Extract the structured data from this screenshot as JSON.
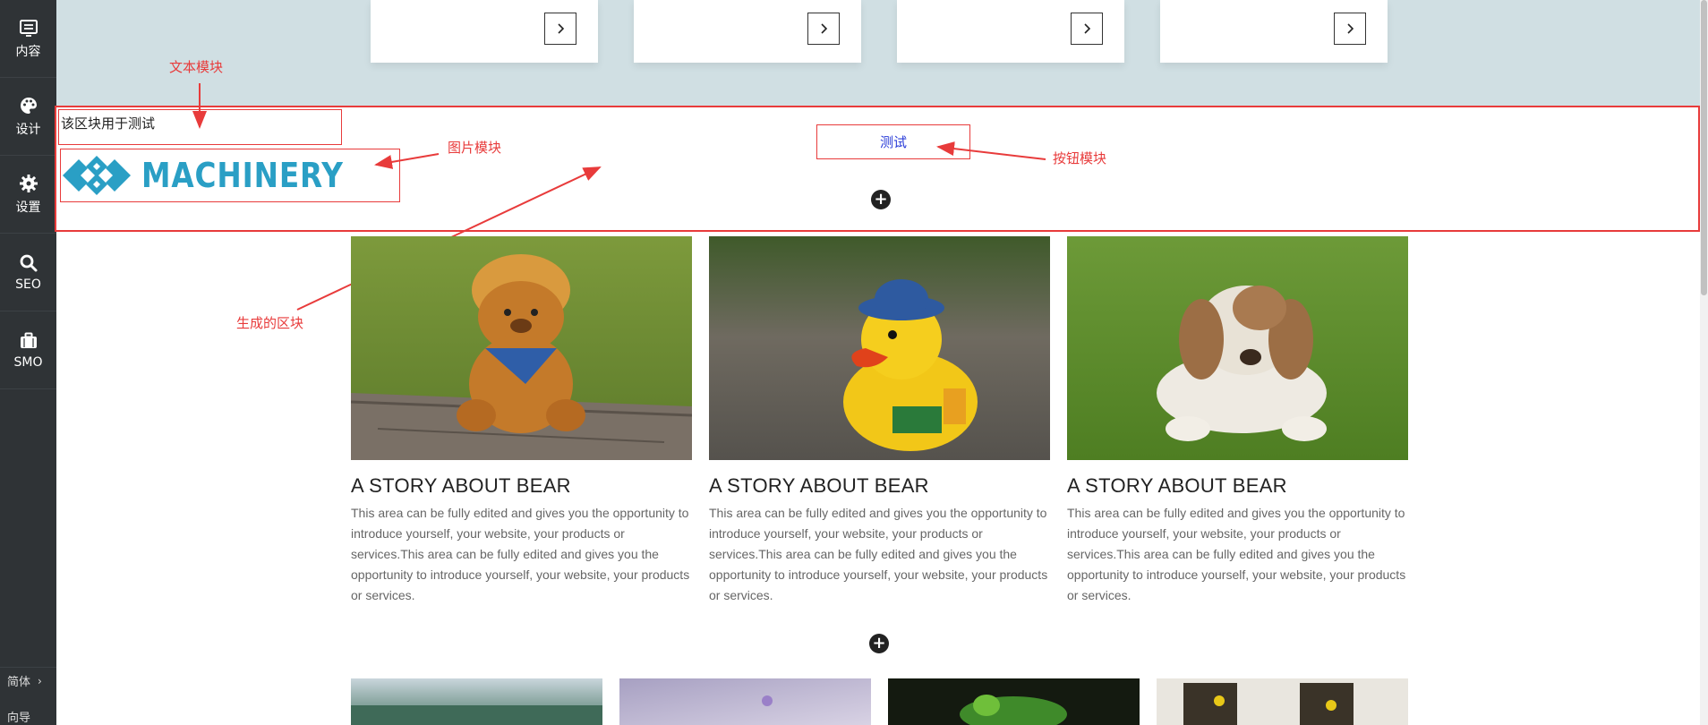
{
  "sidebar": {
    "items": [
      {
        "label": "内容",
        "icon": "content-icon"
      },
      {
        "label": "设计",
        "icon": "palette-icon"
      },
      {
        "label": "设置",
        "icon": "gear-icon"
      },
      {
        "label": "SEO",
        "icon": "search-icon"
      },
      {
        "label": "SMO",
        "icon": "briefcase-icon"
      }
    ],
    "language": "简体",
    "guide": "向导"
  },
  "top_cards": {
    "arrow_icon": "chevron-right-icon",
    "count": 4
  },
  "generated_block": {
    "text_module": "该区块用于测试",
    "logo_text": "MACHINERY",
    "button_label": "测试"
  },
  "annotations": {
    "text_module": "文本模块",
    "image_module": "图片模块",
    "button_module": "按钮模块",
    "generated_block": "生成的区块"
  },
  "cards": [
    {
      "title": "A STORY ABOUT BEAR",
      "body": "This area can be fully edited and gives you the opportunity to introduce yourself, your website, your products or services.This area can be fully edited and gives you the opportunity to introduce yourself, your website, your products or services.",
      "image": "teddy-bear-photo"
    },
    {
      "title": "A STORY ABOUT BEAR",
      "body": "This area can be fully edited and gives you the opportunity to introduce yourself, your website, your products or services.This area can be fully edited and gives you the opportunity to introduce yourself, your website, your products or services.",
      "image": "rubber-duck-photo"
    },
    {
      "title": "A STORY ABOUT BEAR",
      "body": "This area can be fully edited and gives you the opportunity to introduce yourself, your website, your products or services.This area can be fully edited and gives you the opportunity to introduce yourself, your website, your products or services.",
      "image": "plush-dog-photo"
    }
  ],
  "colors": {
    "annotation": "#e83b3b",
    "logo": "#2a9fc5",
    "button_text": "#2a3cd8",
    "sidebar": "#2f3336",
    "top_band": "#d0dfe3"
  }
}
